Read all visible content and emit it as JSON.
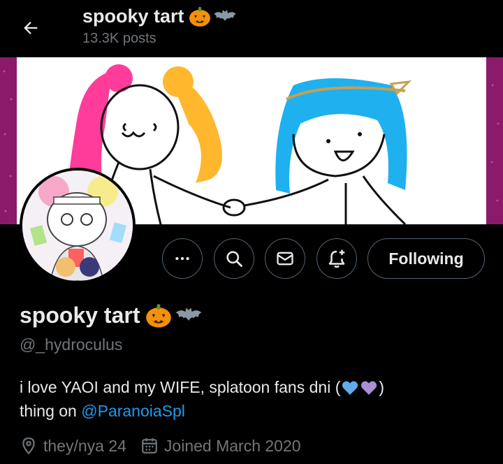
{
  "header": {
    "title": "spooky tart",
    "post_count": "13.3K posts",
    "back_icon": "arrow-left-icon"
  },
  "profile": {
    "display_name": "spooky tart",
    "name_emojis": [
      "pumpkin-emoji",
      "bat-emoji"
    ],
    "handle": "@_hydroculus",
    "bio": {
      "line1": "i love YAOI and my WIFE, splatoon fans dni (",
      "line1_end": ")",
      "hearts": [
        "light-blue-heart-emoji",
        "purple-heart-emoji"
      ],
      "line2_prefix": "thing on ",
      "mention": "@ParanoiaSpl"
    },
    "pronouns_age": "they/nya 24",
    "joined": "Joined March 2020"
  },
  "actions": {
    "more_icon": "more-icon",
    "search_icon": "search-icon",
    "message_icon": "envelope-icon",
    "notify_icon": "bell-plus-icon",
    "follow_label": "Following"
  },
  "colors": {
    "background": "#000000",
    "text": "#e7e9ea",
    "secondary": "#71767b",
    "accent": "#1d9bf0",
    "border": "#536471",
    "banner_side": "#8b1a6b"
  }
}
